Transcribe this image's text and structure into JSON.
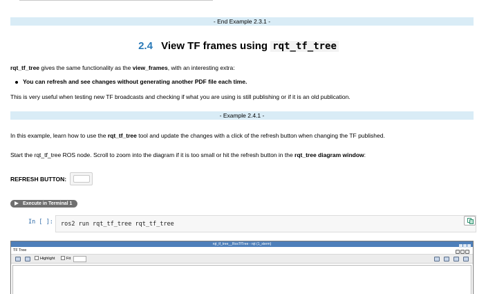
{
  "banners": {
    "end_example": "- End Example 2.3.1 -",
    "example": "- Example 2.4.1 -"
  },
  "section": {
    "number": "2.4",
    "title_prefix": "View TF frames using",
    "title_code": "rqt_tf_tree"
  },
  "intro": {
    "tool": "rqt_tf_tree",
    "text1": " gives the same functionality as the ",
    "compare_tool": "view_frames",
    "text2": ", with an interesting extra:"
  },
  "bullet": "You can refresh and see changes without generating another PDF file each time.",
  "note": "This is very useful when testing new TF broadcasts and checking if what you are using is still publishing or if it is an old publication.",
  "example_text": {
    "p1_before": "In this example, learn how to use the ",
    "p1_tool": "rqt_tf_tree",
    "p1_after": " tool and update the changes with a click of the refresh button when changing the TF published.",
    "p2_before": "Start the rqt_tf_tree ROS node. Scroll to zoom into the diagram if it is too small or hit the refresh button in the ",
    "p2_bold": "rqt_tree diagram window",
    "p2_after": ":"
  },
  "refresh_label": "REFRESH BUTTON:",
  "execute_label": "Execute in Terminal 1",
  "code_cell": {
    "prompt": "In [ ]:",
    "code": "ros2 run rqt_tf_tree rqt_tf_tree"
  },
  "app_window": {
    "title": "rqt_tf_tree__RosTfTree - rqt (1_xterm)",
    "tab": "TF Tree",
    "highlight_label": "Highlight",
    "fit_label": "Fit"
  },
  "colors": {
    "banner": "#d9ecf6",
    "section_number": "#2a7ab8",
    "prompt": "#2e6ba8",
    "pill": "#6f6f6f",
    "window_title": "#4e7fba"
  }
}
